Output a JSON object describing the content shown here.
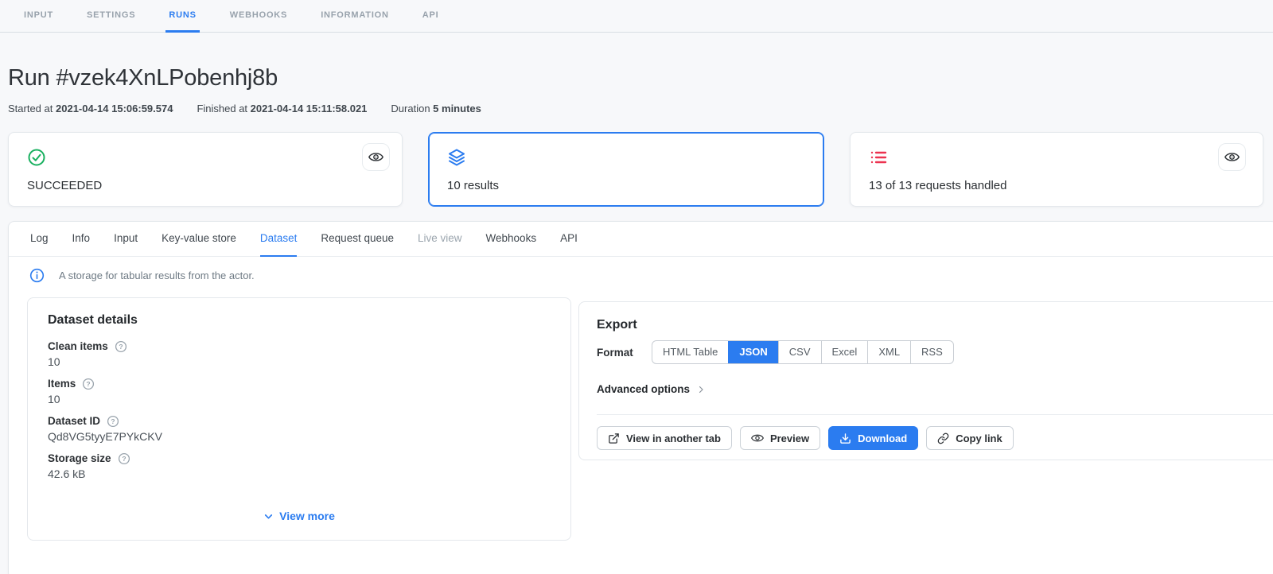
{
  "colors": {
    "accent": "#2b7cf0",
    "success": "#18b05f",
    "danger": "#ec3350"
  },
  "top_tabs": {
    "active": "RUNS",
    "items": [
      {
        "label": "INPUT"
      },
      {
        "label": "SETTINGS"
      },
      {
        "label": "RUNS"
      },
      {
        "label": "WEBHOOKS"
      },
      {
        "label": "INFORMATION"
      },
      {
        "label": "API"
      }
    ]
  },
  "header": {
    "title": "Run #vzek4XnLPobenhj8b",
    "meta": [
      {
        "label": "Started at",
        "value": "2021-04-14 15:06:59.574"
      },
      {
        "label": "Finished at",
        "value": "2021-04-14 15:11:58.021"
      },
      {
        "label": "Duration",
        "value": "5 minutes"
      }
    ]
  },
  "status_cards": [
    {
      "icon": "check-circle-icon",
      "label": "SUCCEEDED"
    },
    {
      "icon": "layers-icon",
      "label": "10 results"
    },
    {
      "icon": "list-icon",
      "label": "13 of 13 requests handled"
    }
  ],
  "panel": {
    "active_tab": "Dataset",
    "disabled_tab": "Live view",
    "tabs": [
      {
        "label": "Log"
      },
      {
        "label": "Info"
      },
      {
        "label": "Input"
      },
      {
        "label": "Key-value store"
      },
      {
        "label": "Dataset"
      },
      {
        "label": "Request queue"
      },
      {
        "label": "Live view"
      },
      {
        "label": "Webhooks"
      },
      {
        "label": "API"
      }
    ],
    "info_text": "A storage for tabular results from the actor."
  },
  "dataset_details": {
    "title": "Dataset details",
    "fields": [
      {
        "label": "Clean items",
        "value": "10"
      },
      {
        "label": "Items",
        "value": "10"
      },
      {
        "label": "Dataset ID",
        "value": "Qd8VG5tyyE7PYkCKV"
      },
      {
        "label": "Storage size",
        "value": "42.6 kB"
      }
    ],
    "view_more_label": "View more"
  },
  "export": {
    "title": "Export",
    "format_label": "Format",
    "selected_format": "JSON",
    "formats": [
      "HTML Table",
      "JSON",
      "CSV",
      "Excel",
      "XML",
      "RSS"
    ],
    "advanced_label": "Advanced options",
    "buttons": [
      {
        "label": "View in another tab",
        "icon": "external-link-icon"
      },
      {
        "label": "Preview",
        "icon": "eye-icon"
      },
      {
        "label": "Download",
        "icon": "download-icon"
      },
      {
        "label": "Copy link",
        "icon": "link-icon"
      }
    ]
  }
}
